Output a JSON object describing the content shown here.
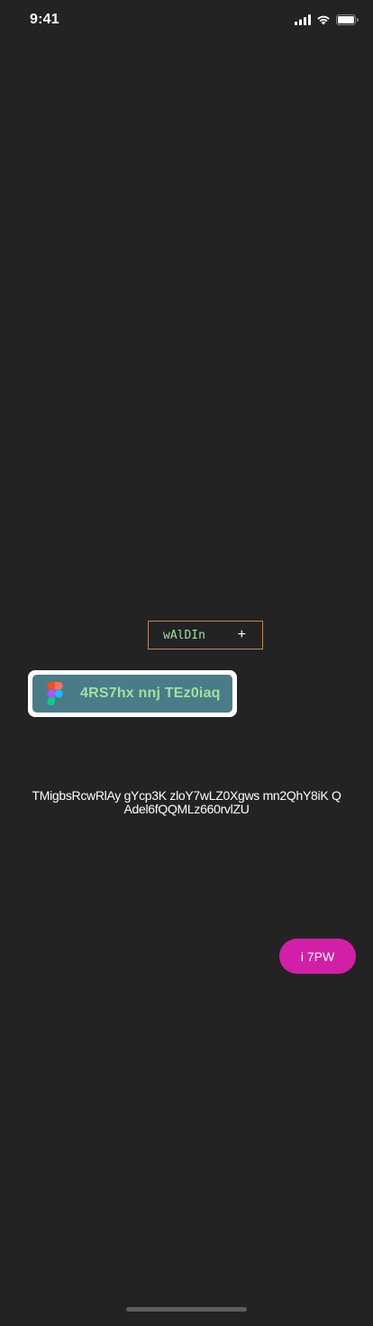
{
  "status_bar": {
    "time": "9:41",
    "icons": [
      "cellular-signal-icon",
      "wifi-icon",
      "battery-icon"
    ]
  },
  "chip_button": {
    "label": "wAlDIn",
    "icon": "plus-icon",
    "icon_glyph": "+",
    "border_color": "#b98b5a",
    "text_color": "#9fe39f"
  },
  "figma_button": {
    "label": "4RS7hx nnj TEz0iaq",
    "icon": "figma-logo-icon",
    "background_color": "#497c87",
    "text_color": "#9fe39f"
  },
  "paragraph": {
    "line1": "TMigbsRcwRlAy gYcp3K zloY7wLZ0Xgws mn2QhY8iK Q",
    "line2": "Adel6fQQMLz660rvlZU"
  },
  "action_button": {
    "label": "i 7PW",
    "background_color": "#d21fa8"
  },
  "colors": {
    "background": "#232323"
  }
}
